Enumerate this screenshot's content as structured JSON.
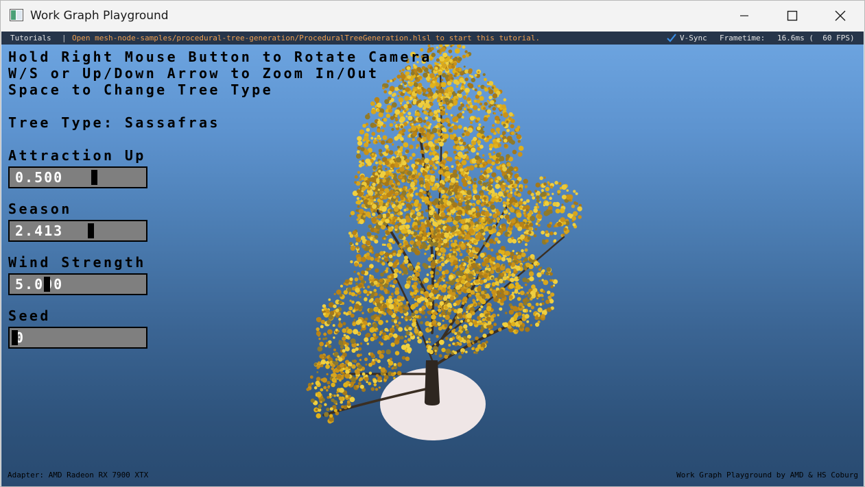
{
  "window": {
    "title": "Work Graph Playground"
  },
  "menubar": {
    "tutorials_label": "Tutorials",
    "separator": "|",
    "hint": "Open mesh-node-samples/procedural-tree-generation/ProceduralTreeGeneration.hlsl to start this tutorial.",
    "vsync_label": "V-Sync",
    "vsync_checked": true,
    "frametime_label": "Frametime:",
    "frametime_value": "16.6ms (  60 FPS)"
  },
  "instructions": [
    "Hold Right Mouse Button to Rotate Camera",
    "W/S or Up/Down Arrow to Zoom In/Out",
    "Space to Change Tree Type"
  ],
  "tree_type_line": "Tree Type: Sassafras",
  "controls": {
    "attraction_up": {
      "label": "Attraction Up",
      "value": "0.500"
    },
    "season": {
      "label": "Season",
      "value": "2.413"
    },
    "wind_strength": {
      "label": "Wind Strength",
      "value": "5.000"
    },
    "seed": {
      "label": "Seed",
      "value": "0"
    }
  },
  "footer": {
    "adapter": "Adapter: AMD Radeon RX 7900 XTX",
    "credit": "Work Graph Playground by AMD & HS Coburg"
  },
  "colors": {
    "menubar_bg": "#26354a",
    "hint_text": "#f0a050",
    "checkmark": "#3a8ee6",
    "foliage": "#d4a21a",
    "trunk": "#2e2620",
    "ground_disc": "#efe6e6"
  }
}
